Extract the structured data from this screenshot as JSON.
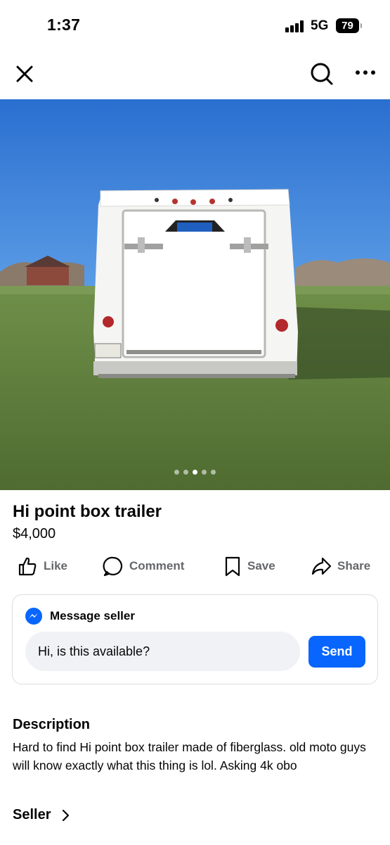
{
  "status_bar": {
    "time": "1:37",
    "network": "5G",
    "battery": "79"
  },
  "nav": {
    "close_icon": "close-icon",
    "search_icon": "search-icon",
    "more_icon": "more-icon"
  },
  "photo": {
    "description_icon": "trailer-photo",
    "page_count": 5,
    "active_page": 3
  },
  "listing": {
    "title": "Hi point box trailer",
    "price": "$4,000"
  },
  "actions": [
    {
      "label": "Like",
      "icon": "thumbs-up-icon"
    },
    {
      "label": "Comment",
      "icon": "comment-icon"
    },
    {
      "label": "Save",
      "icon": "bookmark-icon"
    },
    {
      "label": "Share",
      "icon": "share-icon"
    }
  ],
  "message_card": {
    "heading": "Message seller",
    "input_value": "Hi, is this available?",
    "send_label": "Send"
  },
  "description": {
    "heading": "Description",
    "body": "Hard to find Hi point box trailer made of fiberglass. old moto guys will know exactly what this thing is lol. Asking 4k obo"
  },
  "seller": {
    "label": "Seller"
  },
  "colors": {
    "accent": "#0866ff",
    "secondary_text": "#65676b",
    "input_bg": "#f0f2f5"
  }
}
